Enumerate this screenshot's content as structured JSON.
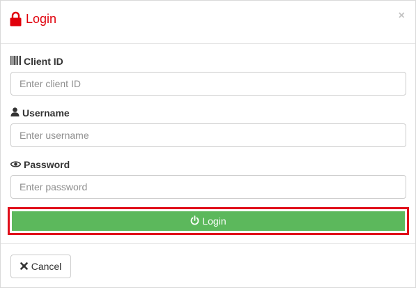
{
  "header": {
    "title": "Login",
    "title_color": "#e0000b",
    "title_icon": "lock-icon",
    "close_symbol": "×"
  },
  "form": {
    "client_id": {
      "label": "Client ID",
      "icon": "barcode-icon",
      "placeholder": "Enter client ID",
      "value": ""
    },
    "username": {
      "label": "Username",
      "icon": "user-icon",
      "placeholder": "Enter username",
      "value": ""
    },
    "password": {
      "label": "Password",
      "icon": "eye-icon",
      "placeholder": "Enter password",
      "value": ""
    },
    "login_button": {
      "label": "Login",
      "icon": "power-icon",
      "color": "#5cb85c",
      "highlight_color": "#e00e1a"
    }
  },
  "footer": {
    "cancel_button": {
      "label": "Cancel",
      "icon": "close-x-icon"
    }
  }
}
